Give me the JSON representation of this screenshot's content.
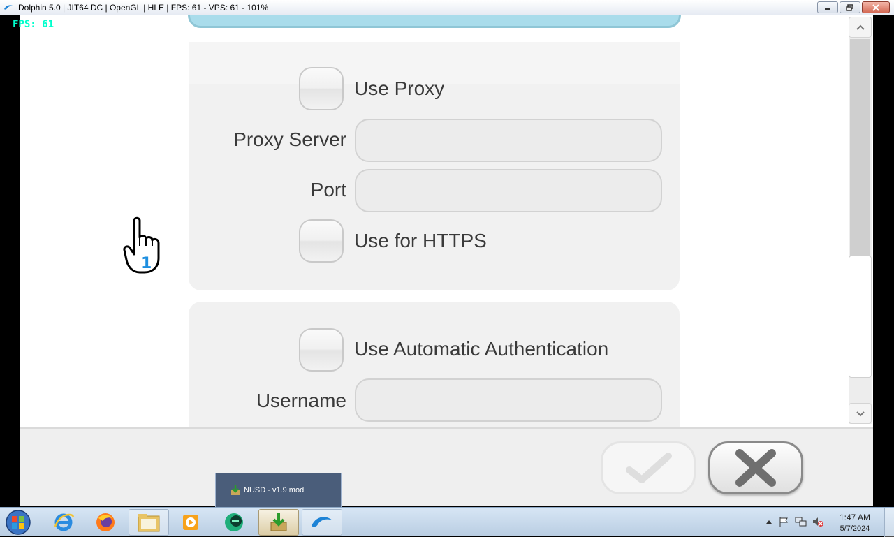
{
  "window": {
    "title": "Dolphin 5.0 | JIT64 DC | OpenGL | HLE | FPS: 61 - VPS: 61 - 101%",
    "controls": [
      "minimize-icon",
      "restore-icon",
      "close-icon"
    ]
  },
  "overlay": {
    "fps_text": "FPS: 61"
  },
  "proxy_panel": {
    "use_proxy_label": "Use Proxy",
    "proxy_server_label": "Proxy Server",
    "proxy_server_value": "",
    "port_label": "Port",
    "port_value": "",
    "use_https_label": "Use for HTTPS"
  },
  "auth_panel": {
    "auto_auth_label": "Use Automatic Authentication",
    "username_label": "Username",
    "username_value": ""
  },
  "cursor": {
    "player_number": "1",
    "icon": "wii-hand-pointer-icon"
  },
  "buttons": {
    "ok_icon": "checkmark-icon",
    "cancel_icon": "x-icon"
  },
  "taskbar": {
    "preview_title": "NUSD - v1.9 mod",
    "items": [
      {
        "name": "start",
        "icon": "windows-start-icon"
      },
      {
        "name": "internet-explorer",
        "icon": "internet-explorer-icon"
      },
      {
        "name": "firefox",
        "icon": "firefox-icon"
      },
      {
        "name": "file-explorer",
        "icon": "folder-icon"
      },
      {
        "name": "media-player",
        "icon": "media-player-icon"
      },
      {
        "name": "app",
        "icon": "green-circle-icon"
      },
      {
        "name": "nusd",
        "icon": "nusd-icon"
      },
      {
        "name": "dolphin",
        "icon": "dolphin-icon"
      }
    ],
    "clock_time": "1:47 AM",
    "clock_date": "5/7/2024"
  },
  "colors": {
    "fps": "#00ffcc",
    "panel": "#f1f1f1",
    "top_button": "#a9dceb",
    "cursor_number": "#1e8fe0"
  }
}
